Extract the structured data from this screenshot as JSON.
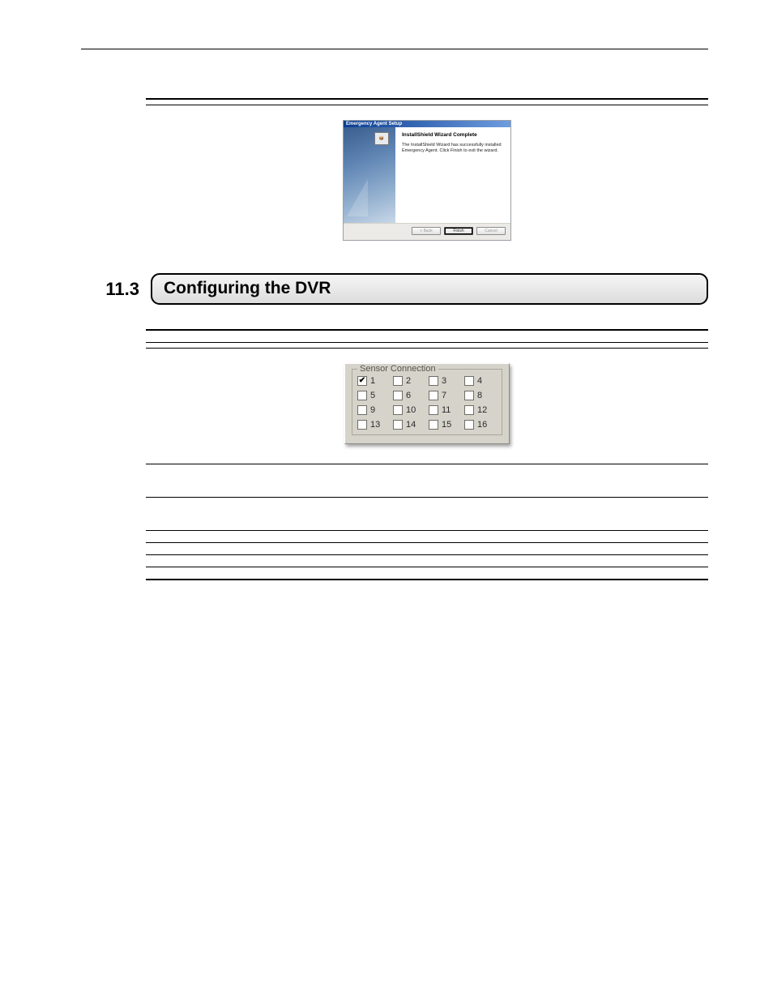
{
  "section": {
    "number": "11.3",
    "title": "Configuring the DVR"
  },
  "wizard": {
    "window_title": "Emergency Agent Setup",
    "heading": "InstallShield Wizard Complete",
    "body_text": "The InstallShield Wizard has successfully installed Emergency Agent. Click Finish to exit the wizard.",
    "side_icon_label": "📦",
    "buttons": {
      "back": "< Back",
      "finish": "Finish",
      "cancel": "Cancel"
    }
  },
  "sensor_panel": {
    "legend": "Sensor Connection",
    "items": [
      {
        "n": "1",
        "checked": true
      },
      {
        "n": "2",
        "checked": false
      },
      {
        "n": "3",
        "checked": false
      },
      {
        "n": "4",
        "checked": false
      },
      {
        "n": "5",
        "checked": false
      },
      {
        "n": "6",
        "checked": false
      },
      {
        "n": "7",
        "checked": false
      },
      {
        "n": "8",
        "checked": false
      },
      {
        "n": "9",
        "checked": false
      },
      {
        "n": "10",
        "checked": false
      },
      {
        "n": "11",
        "checked": false
      },
      {
        "n": "12",
        "checked": false
      },
      {
        "n": "13",
        "checked": false
      },
      {
        "n": "14",
        "checked": false
      },
      {
        "n": "15",
        "checked": false
      },
      {
        "n": "16",
        "checked": false
      }
    ]
  },
  "checkmark_glyph": "✔"
}
